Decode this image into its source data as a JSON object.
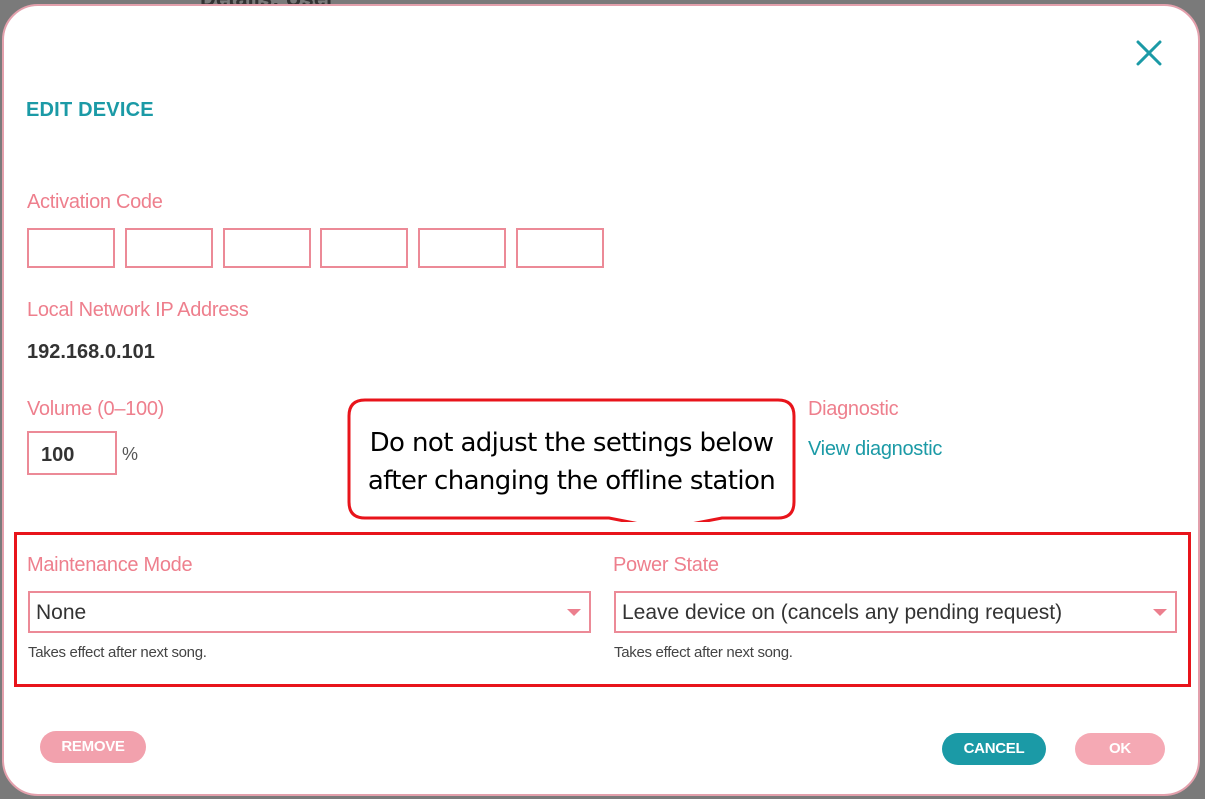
{
  "backdrop": {
    "text": "Details: User"
  },
  "dialog": {
    "title": "EDIT DEVICE",
    "close_icon": "close-icon"
  },
  "activation_code": {
    "label": "Activation Code",
    "values": [
      "",
      "",
      "",
      "",
      "",
      ""
    ]
  },
  "network": {
    "label": "Local Network IP Address",
    "ip": "192.168.0.101"
  },
  "volume": {
    "label": "Volume (0–100)",
    "value": "100",
    "unit": "%"
  },
  "diagnostic": {
    "label": "Diagnostic",
    "link": "View diagnostic"
  },
  "callout": {
    "line1": "Do not adjust the settings below",
    "line2": "after changing the offline station"
  },
  "maintenance": {
    "label": "Maintenance Mode",
    "selected": "None",
    "hint": "Takes effect after next song."
  },
  "power": {
    "label": "Power State",
    "selected": "Leave device on (cancels any pending request)",
    "hint": "Takes effect after next song."
  },
  "buttons": {
    "remove": "REMOVE",
    "cancel": "CANCEL",
    "ok": "OK"
  },
  "colors": {
    "accent_teal": "#1b9aa6",
    "label_pink": "#ee7f8d",
    "highlight_red": "#e8141b"
  }
}
